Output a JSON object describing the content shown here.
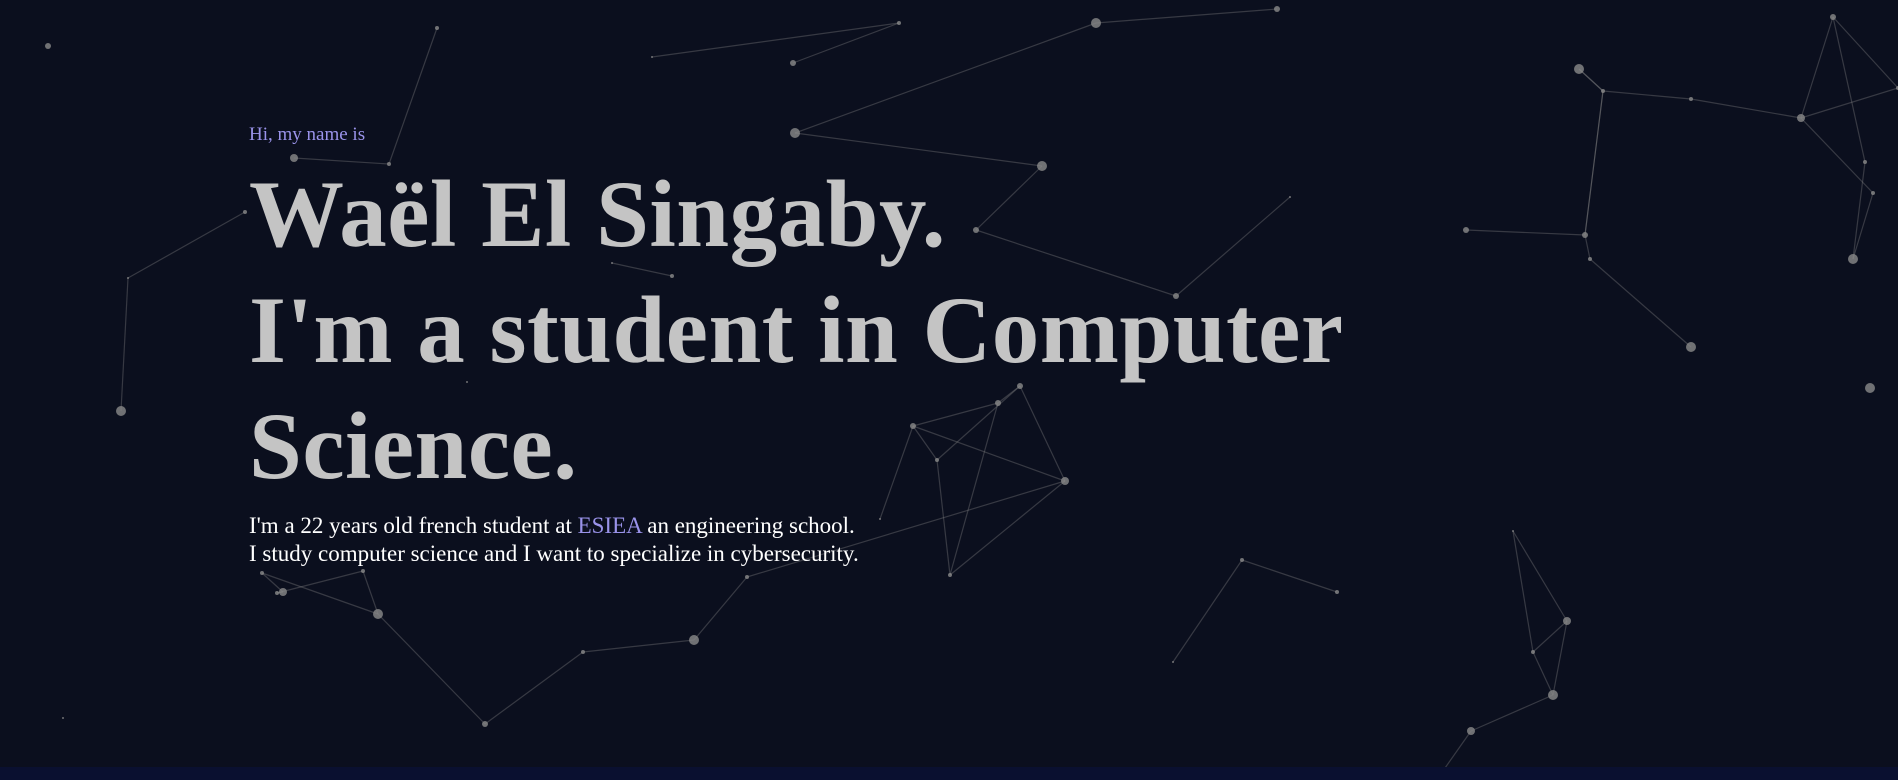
{
  "hero": {
    "greeting": "Hi, my name is",
    "name_line": "Waël El Singaby.",
    "role_line_1": "I'm a student in Computer",
    "role_line_2": "Science.",
    "bio_line_1_prefix": "I'm a 22 years old french student at ",
    "bio_school": "ESIEA",
    "bio_line_1_suffix": " an engineering school.",
    "bio_line_2": "I study computer science and I want to specialize in cybersecurity."
  },
  "colors": {
    "background": "#0b0f1e",
    "accent": "#9a93ea",
    "headline": "#c4c4c4",
    "body_text": "#ffffff",
    "particle": "#8a8a8a"
  }
}
